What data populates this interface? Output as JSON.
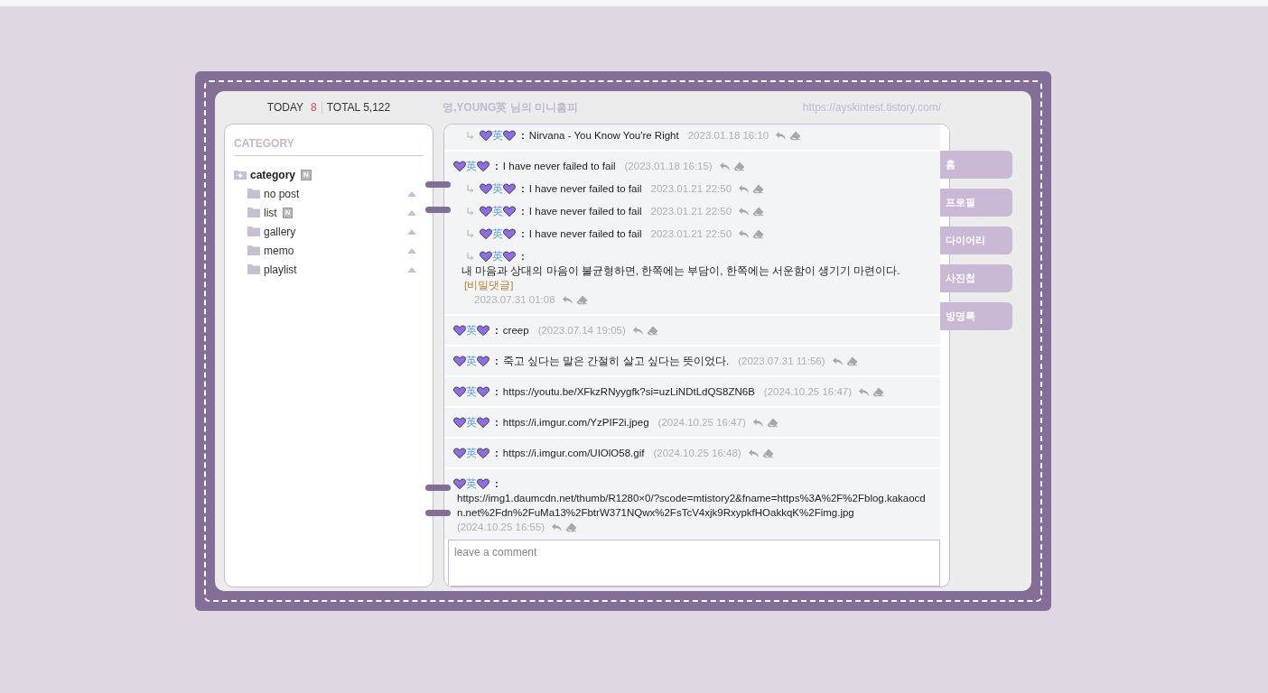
{
  "header": {
    "today_label": "TODAY",
    "today_count": "8",
    "total_label": "TOTAL 5,122",
    "title": "영,YOUNG英 님의 미니홈피",
    "url": "https://ayskintest.tistory.com/"
  },
  "sidebar": {
    "heading": "CATEGORY",
    "root": {
      "label": "category",
      "badge": "N",
      "children": [
        {
          "label": "no post"
        },
        {
          "label": "list",
          "badge": "N"
        },
        {
          "label": "gallery"
        },
        {
          "label": "memo"
        },
        {
          "label": "playlist"
        }
      ]
    }
  },
  "threads": [
    {
      "replies": [
        {
          "author": "英",
          "separator": ":",
          "text": "Nirvana - You Know You're Right",
          "date": "2023.01.18 16:10",
          "kind": "inline"
        }
      ]
    },
    {
      "comment": {
        "author": "英",
        "separator": ":",
        "text": "I have never failed to fail",
        "date": "(2023.01.18 16:15)",
        "kind": "inline"
      },
      "replies": [
        {
          "author": "英",
          "separator": ":",
          "text": "I have never failed to fail",
          "date": "2023.01.21 22:50",
          "kind": "inline"
        },
        {
          "author": "英",
          "separator": ":",
          "text": "I have never failed to fail",
          "date": "2023.01.21 22:50",
          "kind": "inline"
        },
        {
          "author": "英",
          "separator": ":",
          "text": "I have never failed to fail",
          "date": "2023.01.21 22:50",
          "kind": "inline"
        },
        {
          "author": "英",
          "separator": ":",
          "text": "내 마음과 상대의 마음이 불균형하면, 한쪽에는 부담이, 한쪽에는 서운함이 생기기 마련이다.",
          "tag": "[비밀댓글]",
          "date": "2023.07.31 01:08",
          "kind": "block"
        }
      ]
    },
    {
      "comment": {
        "author": "英",
        "separator": ":",
        "text": "creep",
        "date": "(2023.07.14 19:05)",
        "kind": "inline"
      }
    },
    {
      "comment": {
        "author": "英",
        "separator": ":",
        "text": "죽고 싶다는 말은 간절히 살고 싶다는 뜻이었다.",
        "date": "(2023.07.31 11:56)",
        "kind": "inline"
      }
    },
    {
      "comment": {
        "author": "英",
        "separator": ":",
        "text": "https://youtu.be/XFkzRNyygfk?si=uzLiNDtLdQS8ZN6B",
        "date": "(2024.10.25 16:47)",
        "kind": "inline"
      }
    },
    {
      "comment": {
        "author": "英",
        "separator": ":",
        "text": "https://i.imgur.com/YzPIF2i.jpeg",
        "date": "(2024.10.25 16:47)",
        "kind": "inline"
      }
    },
    {
      "comment": {
        "author": "英",
        "separator": ":",
        "text": "https://i.imgur.com/UIOlO58.gif",
        "date": "(2024.10.25 16:48)",
        "kind": "inline"
      }
    },
    {
      "comment": {
        "author": "英",
        "separator": ":",
        "text": "https://img1.daumcdn.net/thumb/R1280×0/?scode=mtistory2&fname=https%3A%2F%2Fblog.kakaocdn.net%2Fdn%2FuMa13%2FbtrW371NQwx%2FsTcV4xjk9RxypkfHOakkqK%2Fimg.jpg",
        "date": "(2024.10.25 16:55)",
        "kind": "block"
      }
    }
  ],
  "comment_input": {
    "placeholder": "leave a comment"
  },
  "nav_tabs": [
    "홈",
    "프로필",
    "다이어리",
    "사진첩",
    "방명록"
  ]
}
